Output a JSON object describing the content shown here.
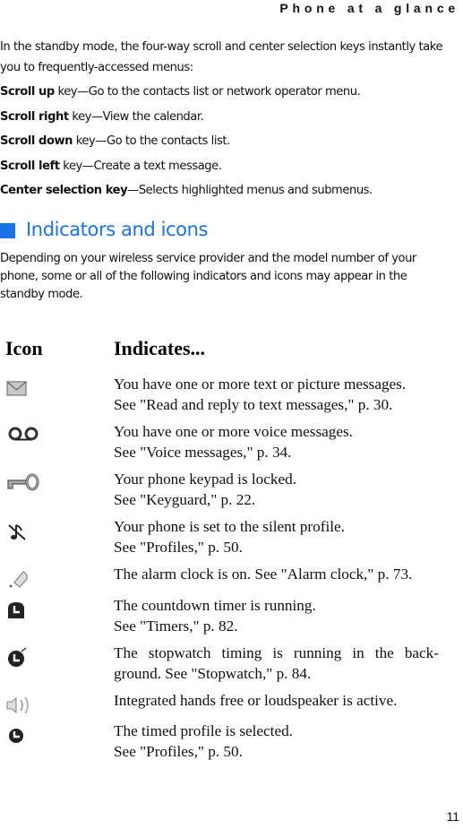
{
  "running_header": "Phone at a glance",
  "intro": "In the standby mode, the four-way scroll and center selection keys instantly take you to frequently-accessed menus:",
  "keys": [
    {
      "key": "Scroll up",
      "rest": " key—Go to the contacts list or network operator menu."
    },
    {
      "key": "Scroll right",
      "rest": " key—View the calendar."
    },
    {
      "key": "Scroll down",
      "rest": " key—Go to the contacts list."
    },
    {
      "key": "Scroll left",
      "rest": " key—Create a text message."
    },
    {
      "key": "Center selection key",
      "rest": "—Selects highlighted menus and submenus."
    }
  ],
  "section": {
    "title": "Indicators and icons",
    "accent_color": "#1a72e6",
    "description": "Depending on your wireless service provider and the model number of your phone, some or all of the following indicators and icons may appear in the standby mode."
  },
  "table": {
    "header_icon": "Icon",
    "header_desc": "Indicates...",
    "rows": [
      {
        "icon": "envelope-icon",
        "lines": [
          "You have one or more text or picture messages.",
          "See \"Read and reply to text messages,\" p. 30."
        ]
      },
      {
        "icon": "voicemail-icon",
        "lines": [
          "You have one or more voice messages.",
          "See \"Voice messages,\" p. 34."
        ]
      },
      {
        "icon": "key-icon",
        "lines": [
          "Your phone keypad is locked.",
          "See \"Keyguard,\" p. 22."
        ]
      },
      {
        "icon": "silent-icon",
        "lines": [
          "Your phone is set to the silent profile.",
          "See \"Profiles,\" p. 50."
        ]
      },
      {
        "icon": "alarm-bell-icon",
        "lines": [
          "The alarm clock is on. See \"Alarm clock,\" p. 73."
        ]
      },
      {
        "icon": "countdown-timer-icon",
        "lines": [
          "The countdown timer is running.",
          "See \"Timers,\" p. 82."
        ]
      },
      {
        "icon": "stopwatch-icon",
        "lines": [
          "The stopwatch timing is running in the back-",
          "ground. See \"Stopwatch,\" p. 84."
        ]
      },
      {
        "icon": "loudspeaker-icon",
        "lines": [
          "Integrated hands free or loudspeaker is active."
        ]
      },
      {
        "icon": "timed-profile-icon",
        "lines": [
          "The timed profile is selected.",
          "See \"Profiles,\" p. 50."
        ]
      }
    ]
  },
  "page_number": "11"
}
